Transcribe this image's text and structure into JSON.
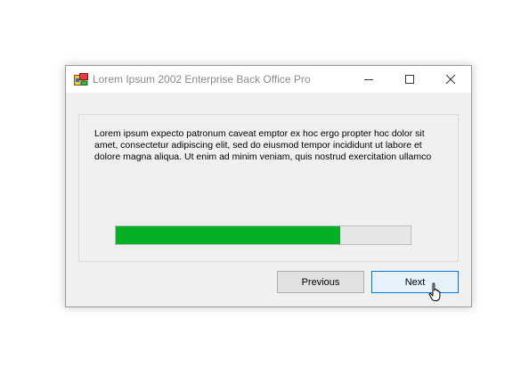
{
  "window": {
    "title": "Lorem Ipsum 2002 Enterprise Back Office Pro",
    "icons": {
      "app": "app-icon",
      "minimize": "minimize-icon",
      "maximize": "maximize-icon",
      "close": "close-icon"
    }
  },
  "content": {
    "message": "Lorem ipsum expecto patronum caveat emptor ex hoc ergo propter hoc dolor sit amet, consectetur adipiscing elit, sed do eiusmod tempor incididunt ut labore et dolore magna aliqua. Ut enim ad minim veniam, quis nostrud exercitation ullamco",
    "progress": {
      "fraction": 0.76,
      "fill_color": "#06b025",
      "track_color": "#e6e6e6"
    }
  },
  "buttons": {
    "previous_label": "Previous",
    "next_label": "Next"
  },
  "colors": {
    "accent": "#0078d7",
    "window_bg": "#f0f0f0"
  }
}
